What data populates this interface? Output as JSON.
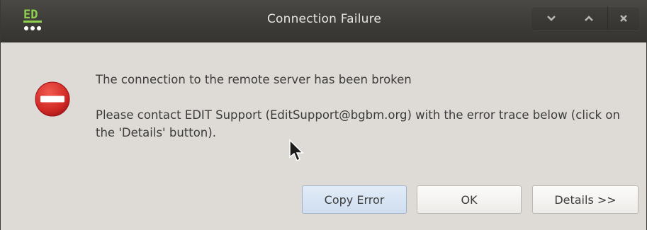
{
  "window": {
    "title": "Connection Failure",
    "app_logo_icon": "edit-app-logo-icon",
    "controls": {
      "minimize_icon": "chevron-down-icon",
      "maximize_icon": "chevron-up-icon",
      "close_icon": "close-icon"
    }
  },
  "dialog": {
    "icon": "error-icon",
    "message_line1": "The connection to the remote server has been broken",
    "message_line2": "Please contact EDIT Support (EditSupport@bgbm.org) with the error trace below (click on the 'Details' button)."
  },
  "buttons": {
    "copy_error": "Copy Error",
    "ok": "OK",
    "details": "Details >>"
  },
  "colors": {
    "titlebar": "#3f3e3a",
    "dialog_bg": "#dedad5",
    "error_red": "#d6262a",
    "default_button": "#d6e4f3"
  }
}
